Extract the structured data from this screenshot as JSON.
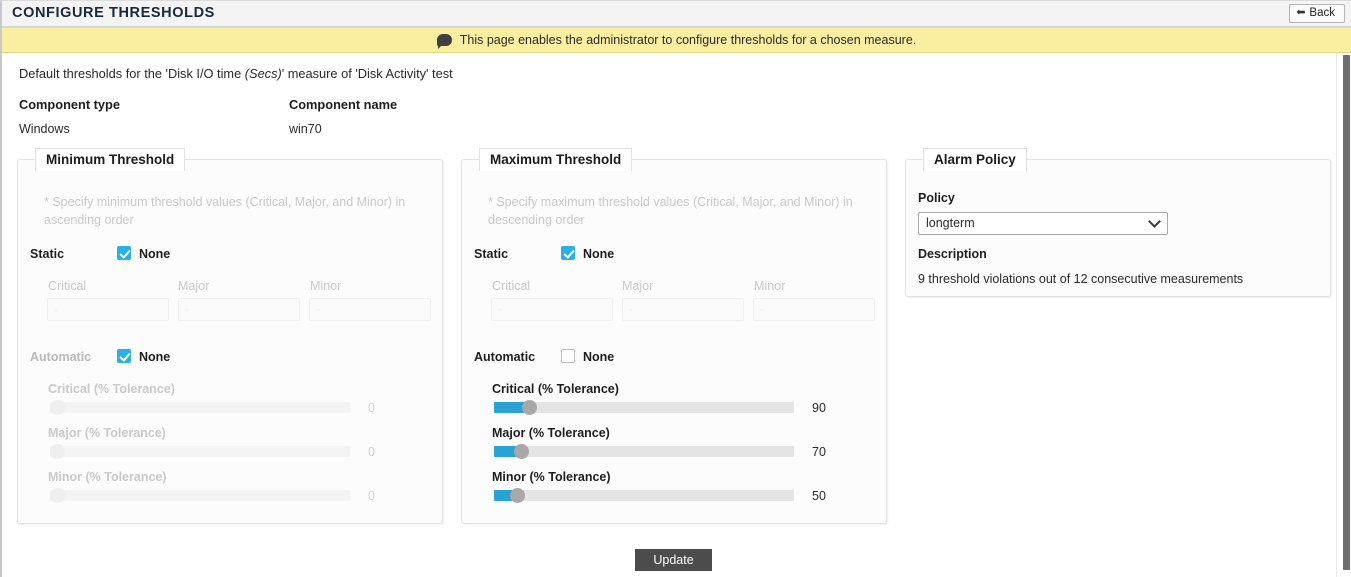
{
  "header": {
    "title": "CONFIGURE THRESHOLDS",
    "back_label": "Back",
    "back_icon": "back-arrow-icon"
  },
  "banner": {
    "icon": "speech-bubble-icon",
    "text": "This page enables the administrator to configure thresholds for a chosen measure."
  },
  "intro": {
    "prefix": "Default thresholds for the 'Disk I/O time ",
    "emphasis": "(Secs)",
    "suffix": "' measure of 'Disk Activity' test"
  },
  "meta": {
    "component_type_label": "Component type",
    "component_name_label": "Component name",
    "component_type_value": "Windows",
    "component_name_value": "win70"
  },
  "minimum": {
    "legend": "Minimum Threshold",
    "hint": "* Specify minimum threshold values (Critical, Major, and Minor) in ascending order",
    "static_label": "Static",
    "static_none_label": "None",
    "static_none_checked": true,
    "automatic_label": "Automatic",
    "automatic_none_label": "None",
    "automatic_none_checked": true,
    "fields": [
      {
        "label": "Critical",
        "value": "",
        "placeholder": "-"
      },
      {
        "label": "Major",
        "value": "",
        "placeholder": "-"
      },
      {
        "label": "Minor",
        "value": "",
        "placeholder": "-"
      }
    ],
    "sliders": [
      {
        "label": "Critical (% Tolerance)",
        "value": "0"
      },
      {
        "label": "Major (% Tolerance)",
        "value": "0"
      },
      {
        "label": "Minor (% Tolerance)",
        "value": "0"
      }
    ]
  },
  "maximum": {
    "legend": "Maximum Threshold",
    "hint": "* Specify maximum threshold values (Critical, Major, and Minor) in descending order",
    "static_label": "Static",
    "static_none_label": "None",
    "static_none_checked": true,
    "automatic_label": "Automatic",
    "automatic_none_label": "None",
    "automatic_none_checked": false,
    "fields": [
      {
        "label": "Critical",
        "value": "",
        "placeholder": "-"
      },
      {
        "label": "Major",
        "value": "",
        "placeholder": "-"
      },
      {
        "label": "Minor",
        "value": "",
        "placeholder": "-"
      }
    ],
    "sliders": [
      {
        "label": "Critical (% Tolerance)",
        "value": "90"
      },
      {
        "label": "Major (% Tolerance)",
        "value": "70"
      },
      {
        "label": "Minor (% Tolerance)",
        "value": "50"
      }
    ]
  },
  "alarm_policy": {
    "legend": "Alarm Policy",
    "policy_label": "Policy",
    "policy_value": "longterm",
    "policy_options": [
      "longterm"
    ],
    "description_label": "Description",
    "description_value": "9 threshold violations out of 12 consecutive measurements",
    "chevron_icon": "chevron-down-icon"
  },
  "footer": {
    "update_label": "Update"
  },
  "colors": {
    "accent_blue": "#29a3d4",
    "checkbox_blue": "#29b0e5",
    "banner_yellow": "#faeea0",
    "button_dark": "#4c4c4c"
  }
}
